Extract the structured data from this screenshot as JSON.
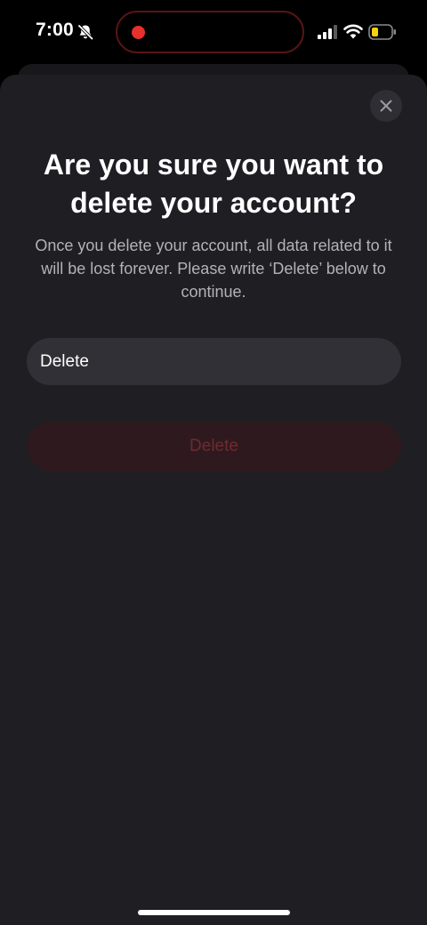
{
  "status_bar": {
    "time": "7:00",
    "icons": {
      "silent": "bell-slash-icon",
      "recording": "record-dot-icon",
      "signal": "cellular-signal-icon",
      "wifi": "wifi-icon",
      "battery": "battery-low-icon"
    },
    "colors": {
      "recording": "#e8302c",
      "battery_level": "#f5d10b"
    }
  },
  "modal": {
    "close_icon": "close-icon",
    "title": "Are you sure you want to delete your account?",
    "description": "Once you delete your account, all data related to it will be lost forever. Please write ‘Delete’ below to continue.",
    "input": {
      "value": "Delete",
      "placeholder": ""
    },
    "delete_button": {
      "label": "Delete",
      "enabled": false
    }
  },
  "colors": {
    "sheet_background": "#1f1e23",
    "input_background": "#303036",
    "danger_button_disabled_bg": "#2e1a1e",
    "danger_button_disabled_text": "#6e2a30"
  }
}
